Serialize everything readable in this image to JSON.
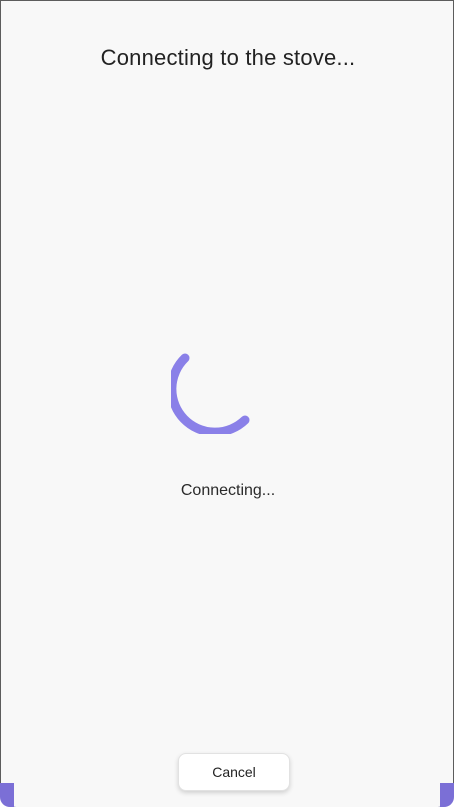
{
  "screen": {
    "title": "Connecting to the stove...",
    "status_text": "Connecting...",
    "cancel_label": "Cancel"
  },
  "spinner": {
    "icon": "loading-spinner-icon",
    "color": "#8a80e8"
  },
  "colors": {
    "background": "#f8f8f8",
    "accent": "#7b6fd6"
  }
}
